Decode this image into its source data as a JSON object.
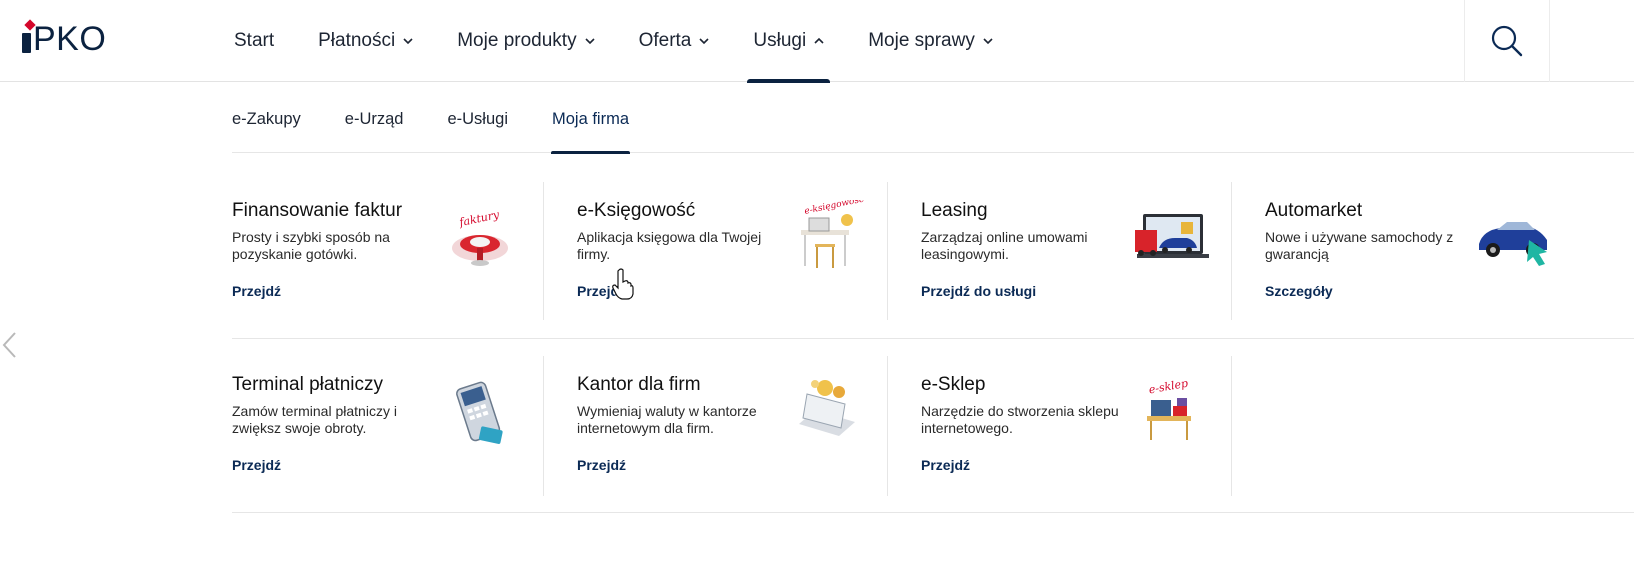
{
  "brand": {
    "logo_text": "PKO",
    "logo_letter_i_color": "#0b2240",
    "accent_red": "#d4072b",
    "navy": "#0b2240"
  },
  "main_nav": {
    "items": [
      {
        "label": "Start",
        "has_dropdown": false
      },
      {
        "label": "Płatności",
        "has_dropdown": true
      },
      {
        "label": "Moje produkty",
        "has_dropdown": true
      },
      {
        "label": "Oferta",
        "has_dropdown": true
      },
      {
        "label": "Usługi",
        "has_dropdown": true,
        "expanded": true
      },
      {
        "label": "Moje sprawy",
        "has_dropdown": true
      }
    ],
    "search_icon": "search-icon"
  },
  "sub_nav": {
    "items": [
      {
        "label": "e-Zakupy"
      },
      {
        "label": "e-Urząd"
      },
      {
        "label": "e-Usługi"
      },
      {
        "label": "Moja firma",
        "active": true
      }
    ]
  },
  "cards": [
    {
      "title": "Finansowanie faktur",
      "description": "Prosty i szybki sposób na pozyskanie gotówki.",
      "link": "Przejdź",
      "icon": "invoice-financing-illustration"
    },
    {
      "title": "e-Księgowość",
      "description": "Aplikacja księgowa dla Twojej firmy.",
      "link": "Przejdź",
      "icon": "accounting-desk-illustration"
    },
    {
      "title": "Leasing",
      "description": "Zarządzaj online umowami leasingowymi.",
      "link": "Przejdź do usługi",
      "icon": "leasing-vehicles-illustration"
    },
    {
      "title": "Automarket",
      "description": "Nowe i używane samochody z gwarancją",
      "link": "Szczegóły",
      "icon": "car-illustration"
    },
    {
      "title": "Terminal płatniczy",
      "description": "Zamów terminal płatniczy i zwiększ swoje obroty.",
      "link": "Przejdź",
      "icon": "payment-terminal-illustration"
    },
    {
      "title": "Kantor dla firm",
      "description": "Wymieniaj waluty w kantorze internetowym dla firm.",
      "link": "Przejdź",
      "icon": "currency-exchange-illustration"
    },
    {
      "title": "e-Sklep",
      "description": "Narzędzie do stworzenia sklepu internetowego.",
      "link": "Przejdź",
      "icon": "e-shop-illustration"
    }
  ],
  "illustration_labels": {
    "finansowanie": "faktury",
    "ksiegowosc": "e-księgowość",
    "sklep": "e-sklep"
  },
  "colors": {
    "link": "#0b2a55",
    "divider": "#e6e6e6",
    "teal_arrow": "#1fb6a3",
    "car_blue": "#1f3f9a",
    "truck_red": "#d8232a"
  }
}
